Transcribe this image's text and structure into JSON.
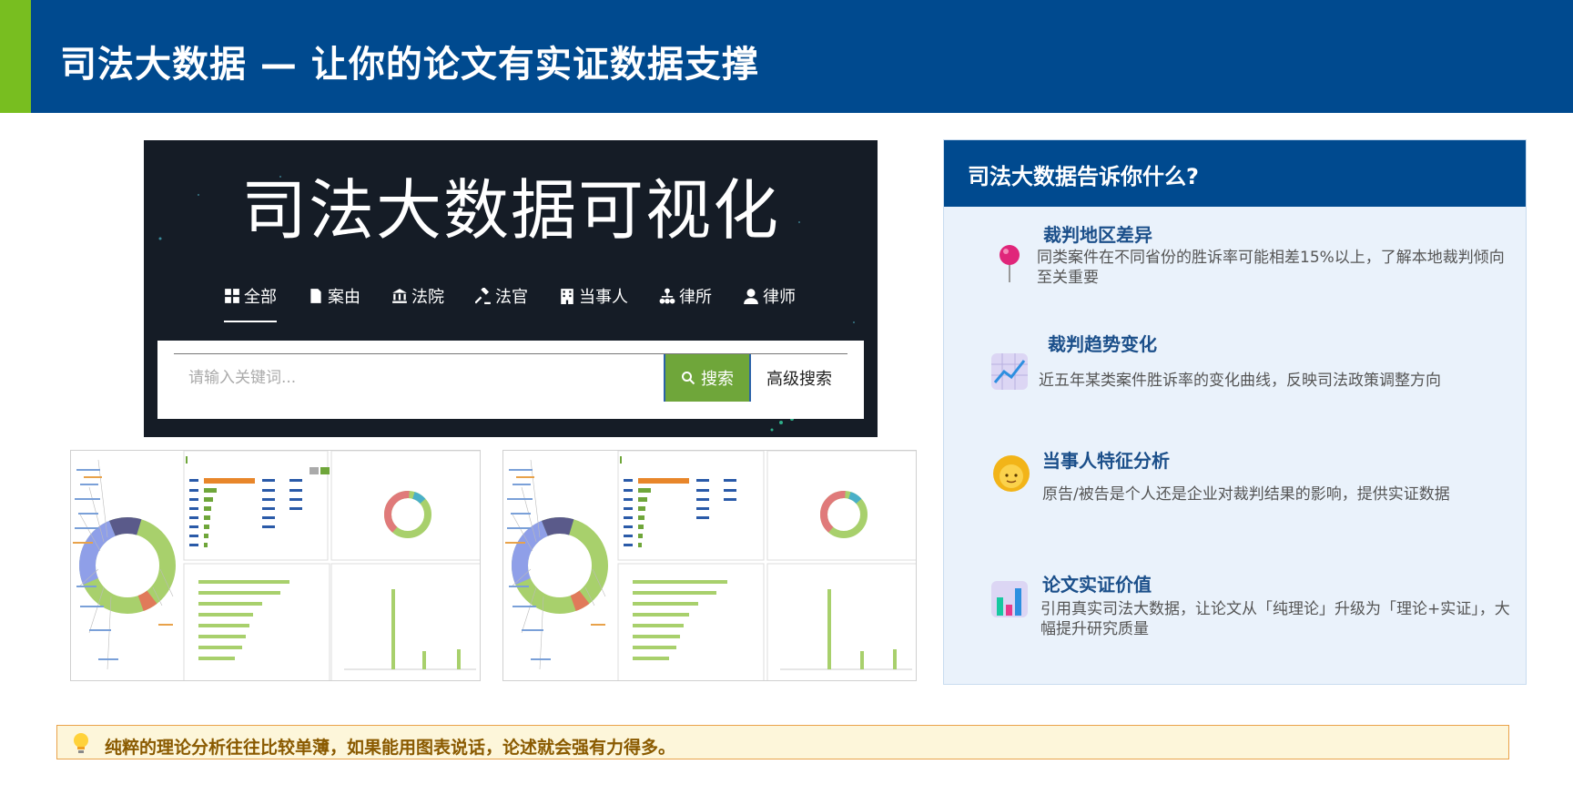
{
  "header": {
    "title": "司法大数据 — 让你的论文有实证数据支撑"
  },
  "hero": {
    "title": "司法大数据可视化",
    "tabs": [
      {
        "label": "全部",
        "icon": "grid-icon",
        "active": true
      },
      {
        "label": "案由",
        "icon": "document-icon",
        "active": false
      },
      {
        "label": "法院",
        "icon": "courthouse-icon",
        "active": false
      },
      {
        "label": "法官",
        "icon": "gavel-icon",
        "active": false
      },
      {
        "label": "当事人",
        "icon": "building-icon",
        "active": false
      },
      {
        "label": "律所",
        "icon": "org-chart-icon",
        "active": false
      },
      {
        "label": "律师",
        "icon": "person-icon",
        "active": false
      }
    ],
    "search": {
      "placeholder": "请输入关键词...",
      "button_label": "搜索",
      "advanced_label": "高级搜索"
    }
  },
  "info_card": {
    "title": "司法大数据告诉你什么?",
    "features": [
      {
        "title": "裁判地区差异",
        "icon": "pushpin-icon",
        "desc": "同类案件在不同省份的胜诉率可能相差15%以上，了解本地裁判倾向至关重要"
      },
      {
        "title": "裁判趋势变化",
        "icon": "trend-chart-icon",
        "desc": "近五年某类案件胜诉率的变化曲线，反映司法政策调整方向"
      },
      {
        "title": "当事人特征分析",
        "icon": "person-face-icon",
        "desc": "原告/被告是个人还是企业对裁判结果的影响，提供实证数据"
      },
      {
        "title": "论文实证价值",
        "icon": "bar-chart-icon",
        "desc": "引用真实司法大数据，让论文从「纯理论」升级为「理论+实证」，大幅提升研究质量"
      }
    ]
  },
  "tip": {
    "icon": "lightbulb-icon",
    "text": "纯粹的理论分析往往比较单薄，如果能用图表说话，论述就会强有力得多。"
  },
  "colors": {
    "header_bg": "#004a8f",
    "accent_green": "#78be20",
    "search_green": "#6fa63a",
    "card_bg": "#eaf2fb",
    "tip_bg": "#fdf6da",
    "tip_border": "#e9a24a"
  }
}
